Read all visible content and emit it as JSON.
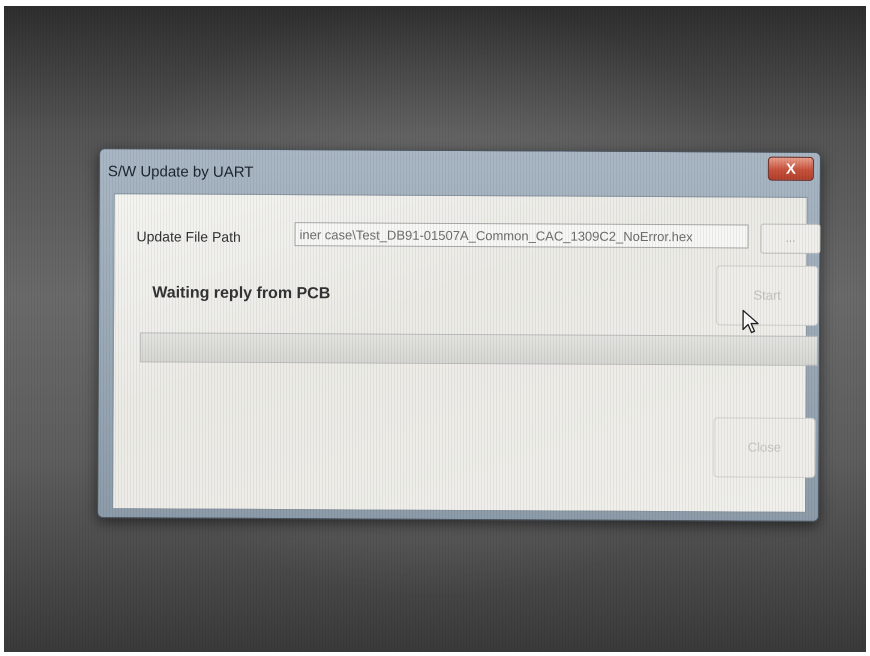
{
  "window": {
    "title": "S/W Update by UART",
    "close_glyph": "X"
  },
  "form": {
    "path_label": "Update File Path",
    "path_value": "iner case\\Test_DB91-01507A_Common_CAC_1309C2_NoError.hex",
    "browse_label": "...",
    "status": "Waiting reply from PCB",
    "start_label": "Start",
    "close_label": "Close",
    "progress": 0
  },
  "icons": {
    "close": "close-icon",
    "cursor": "mouse-pointer-icon"
  },
  "colors": {
    "close_button": "#c9523c",
    "titlebar": "#a9b7c4"
  }
}
